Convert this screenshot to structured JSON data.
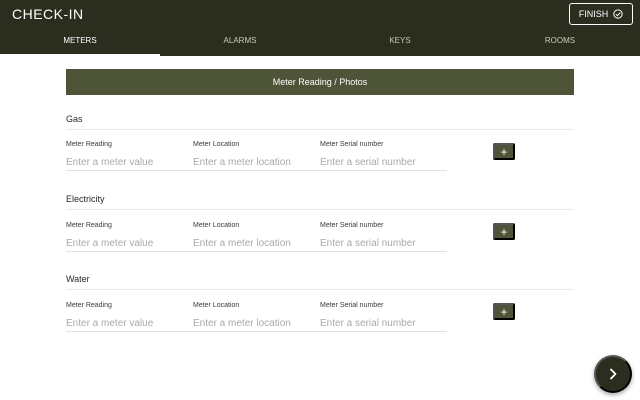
{
  "header": {
    "title": "CHECK-IN",
    "finish_label": "FINISH"
  },
  "tabs": [
    {
      "label": "METERS",
      "active": true
    },
    {
      "label": "ALARMS",
      "active": false
    },
    {
      "label": "KEYS",
      "active": false
    },
    {
      "label": "ROOMS",
      "active": false
    }
  ],
  "section": {
    "title": "Meter Reading / Photos"
  },
  "groups": [
    {
      "title": "Gas",
      "fields": [
        {
          "label": "Meter Reading",
          "placeholder": "Enter a meter value"
        },
        {
          "label": "Meter Location",
          "placeholder": "Enter a meter location"
        },
        {
          "label": "Meter Serial number",
          "placeholder": "Enter a serial number"
        }
      ],
      "add_label": "+"
    },
    {
      "title": "Electricity",
      "fields": [
        {
          "label": "Meter Reading",
          "placeholder": "Enter a meter value"
        },
        {
          "label": "Meter Location",
          "placeholder": "Enter a meter location"
        },
        {
          "label": "Meter Serial number",
          "placeholder": "Enter a serial number"
        }
      ],
      "add_label": "+"
    },
    {
      "title": "Water",
      "fields": [
        {
          "label": "Meter Reading",
          "placeholder": "Enter a meter value"
        },
        {
          "label": "Meter Location",
          "placeholder": "Enter a meter location"
        },
        {
          "label": "Meter Serial number",
          "placeholder": "Enter a serial number"
        }
      ],
      "add_label": "+"
    }
  ],
  "icons": {
    "finish": "check-circle-icon",
    "next": "chevron-right-icon"
  },
  "colors": {
    "header_bg": "#2b2d1f",
    "accent": "#4e5437"
  }
}
